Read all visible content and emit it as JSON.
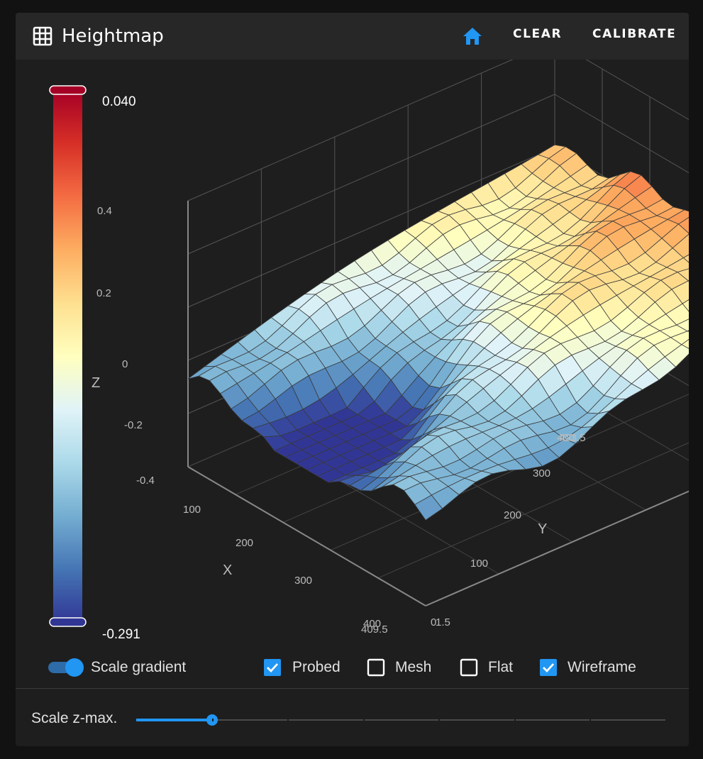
{
  "header": {
    "title": "Heightmap",
    "grid_icon": "grid-icon",
    "home_icon": "home-icon",
    "clear_label": "CLEAR",
    "calibrate_label": "CALIBRATE",
    "accent_color": "#2196f3"
  },
  "colorbar": {
    "max_label": "0.040",
    "min_label": "-0.291",
    "colors": [
      "#a50026",
      "#d73027",
      "#f46d43",
      "#fdae61",
      "#fee090",
      "#ffffbf",
      "#e0f3f8",
      "#abd9e9",
      "#74add1",
      "#4575b4",
      "#313695"
    ]
  },
  "chart_data": {
    "type": "surface3d",
    "z_axis": {
      "label": "Z",
      "ticks": [
        "0.4",
        "0.2",
        "0",
        "-0.2",
        "-0.4"
      ]
    },
    "x_axis": {
      "label": "X",
      "ticks": [
        "100",
        "200",
        "300",
        "400",
        "409.5"
      ]
    },
    "y_axis": {
      "label": "Y",
      "ticks": [
        "100",
        "200",
        "300",
        "400",
        "403.5",
        "0",
        "1.5"
      ]
    },
    "z_range": [
      -0.291,
      0.04
    ],
    "grid": true,
    "wireframe": true,
    "colorscale": "red-yellow-blue"
  },
  "controls": {
    "scale_gradient_label": "Scale gradient",
    "scale_gradient_on": true,
    "probed_label": "Probed",
    "probed_checked": true,
    "mesh_label": "Mesh",
    "mesh_checked": false,
    "flat_label": "Flat",
    "flat_checked": false,
    "wireframe_label": "Wireframe",
    "wireframe_checked": true
  },
  "slider": {
    "label": "Scale z-max.",
    "value_fraction": 0.143,
    "steps": 7
  }
}
